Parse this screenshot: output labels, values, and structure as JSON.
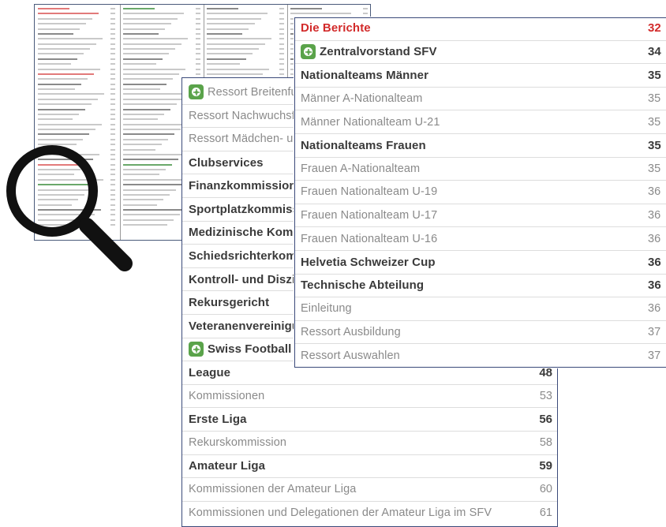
{
  "middle_page": {
    "rows": [
      {
        "label": "Ressort Breitenfussball",
        "page": "",
        "style": "light",
        "logo": true
      },
      {
        "label": "Ressort Nachwuchsfussball",
        "page": "",
        "style": "light",
        "logo": false
      },
      {
        "label": "Ressort Mädchen- und Frauenfussball",
        "page": "",
        "style": "light",
        "logo": false
      },
      {
        "label": "Clubservices",
        "page": "",
        "style": "bold",
        "logo": false
      },
      {
        "label": "Finanzkommission",
        "page": "",
        "style": "bold",
        "logo": false
      },
      {
        "label": "Sportplatzkommission",
        "page": "",
        "style": "bold",
        "logo": false
      },
      {
        "label": "Medizinische Kommission",
        "page": "",
        "style": "bold",
        "logo": false
      },
      {
        "label": "Schiedsrichterkommission",
        "page": "",
        "style": "bold",
        "logo": false
      },
      {
        "label": "Kontroll- und Disziplinarkommission",
        "page": "",
        "style": "bold",
        "logo": false
      },
      {
        "label": "Rekursgericht",
        "page": "",
        "style": "bold",
        "logo": false
      },
      {
        "label": "Veteranenvereinigung",
        "page": "",
        "style": "bold",
        "logo": false
      },
      {
        "label": "Swiss Football",
        "page": "",
        "style": "bold",
        "logo": true
      },
      {
        "label": "League",
        "page": "48",
        "style": "bold",
        "logo": false
      },
      {
        "label": "Kommissionen",
        "page": "53",
        "style": "light",
        "logo": false
      },
      {
        "label": "Erste Liga",
        "page": "56",
        "style": "bold",
        "logo": false
      },
      {
        "label": "Rekurskommission",
        "page": "58",
        "style": "light",
        "logo": false
      },
      {
        "label": "Amateur Liga",
        "page": "59",
        "style": "bold",
        "logo": false
      },
      {
        "label": "Kommissionen der Amateur Liga",
        "page": "60",
        "style": "light",
        "logo": false
      },
      {
        "label": "Kommissionen und Delegationen der Amateur Liga im SFV",
        "page": "61",
        "style": "light",
        "logo": false
      }
    ]
  },
  "front_page": {
    "rows": [
      {
        "label": "Die Berichte",
        "page": "32",
        "style": "red",
        "logo": false
      },
      {
        "label": "Zentralvorstand SFV",
        "page": "34",
        "style": "bold",
        "logo": true
      },
      {
        "label": "Nationalteams Männer",
        "page": "35",
        "style": "bold",
        "logo": false
      },
      {
        "label": "Männer A-Nationalteam",
        "page": "35",
        "style": "light",
        "logo": false
      },
      {
        "label": "Männer Nationalteam U-21",
        "page": "35",
        "style": "light",
        "logo": false
      },
      {
        "label": "Nationalteams Frauen",
        "page": "35",
        "style": "bold",
        "logo": false
      },
      {
        "label": "Frauen A-Nationalteam",
        "page": "35",
        "style": "light",
        "logo": false
      },
      {
        "label": "Frauen Nationalteam U-19",
        "page": "36",
        "style": "light",
        "logo": false
      },
      {
        "label": "Frauen Nationalteam U-17",
        "page": "36",
        "style": "light",
        "logo": false
      },
      {
        "label": "Frauen Nationalteam U-16",
        "page": "36",
        "style": "light",
        "logo": false
      },
      {
        "label": "Helvetia Schweizer Cup",
        "page": "36",
        "style": "bold",
        "logo": false
      },
      {
        "label": "Technische Abteilung",
        "page": "36",
        "style": "bold",
        "logo": false
      },
      {
        "label": "Einleitung",
        "page": "36",
        "style": "light",
        "logo": false
      },
      {
        "label": "Ressort Ausbildung",
        "page": "37",
        "style": "light",
        "logo": false
      },
      {
        "label": "Ressort Auswahlen",
        "page": "37",
        "style": "light",
        "logo": false
      }
    ]
  },
  "colors": {
    "accent_red": "#d22a2a",
    "logo_green": "#5aa34a",
    "border_blue": "#3b4a7a"
  },
  "icons": {
    "magnifier": "magnifying-glass-icon",
    "logo": "football-logo-icon"
  }
}
